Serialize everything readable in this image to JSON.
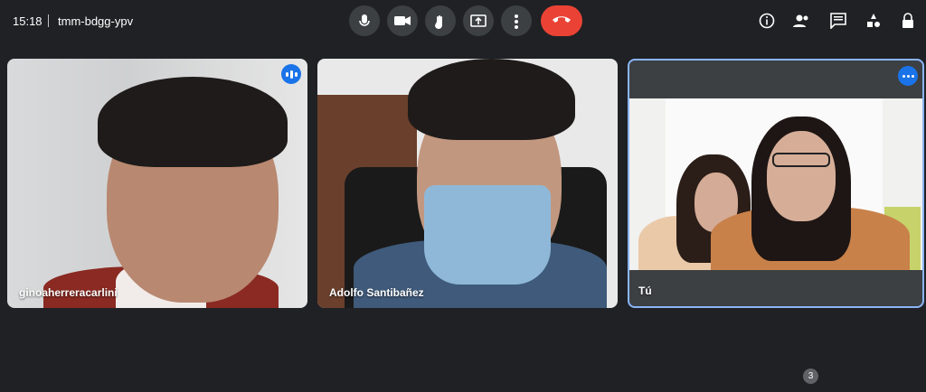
{
  "participants": [
    {
      "name": "ginoaherreracarlini",
      "indicator": "speaking-indicator-icon"
    },
    {
      "name": "Adolfo Santibañez"
    },
    {
      "name": "Tú",
      "indicator": "more-options-icon"
    }
  ],
  "meeting": {
    "time": "15:18",
    "code": "tmm-bdgg-ypv"
  },
  "controls": [
    "microphone-icon",
    "camera-icon",
    "raise-hand-icon",
    "present-screen-icon",
    "more-options-icon",
    "end-call-icon"
  ],
  "side": {
    "people_count": "3",
    "icons": [
      "info-icon",
      "people-icon",
      "chat-icon",
      "activities-icon",
      "host-controls-icon"
    ]
  },
  "colors": {
    "background": "#202124",
    "accent": "#1a73e8",
    "end_call": "#ea4335",
    "active_border": "#8ab4f8"
  }
}
